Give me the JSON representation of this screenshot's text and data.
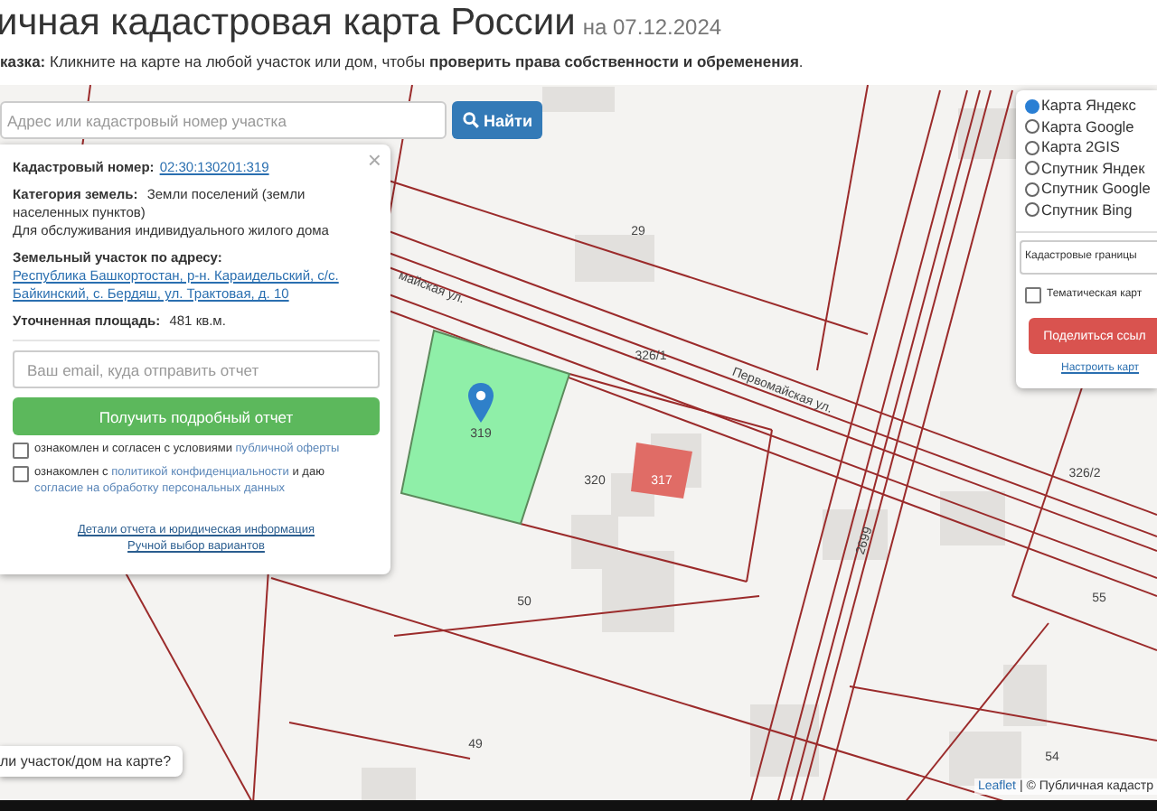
{
  "header": {
    "title": "ичная кадастровая карта России",
    "date": "на 07.12.2024",
    "hint": "**казка:** Кликните на карте на любой участок или дом, чтобы **проверить права собственности и обременения**."
  },
  "search": {
    "placeholder": "Адрес или кадастровый номер участка",
    "button": "Найти"
  },
  "popup": {
    "close": "×",
    "fields": [
      {
        "label": "Кадастровый номер:",
        "value": "02:30:130201:319",
        "kind": "link"
      },
      {
        "label": "Категория земель:",
        "value": "Земли поселений (земли населенных пунктов)",
        "kind": "text"
      },
      {
        "value": "Для обслуживания индивидуального жилого дома",
        "kind": "text"
      },
      {
        "label": "Земельный участок по адресу:",
        "value": "Республика Башкортостан, р-н. Караидельский, с/с. Байкинский, с. Бердяш, ул. Трактовая, д. 10",
        "kind": "link"
      },
      {
        "label": "Уточненная площадь:",
        "value": "481 кв.м.",
        "kind": "text"
      }
    ],
    "email": {
      "placeholder": "Ваш email, куда отправить отчет"
    },
    "report_button": "Получить подробный отчет",
    "agreements": [
      {
        "checked": false,
        "parts": [
          {
            "text": "ознакомлен и согласен с условиями",
            "link": false
          },
          {
            "text": "публичной оферты",
            "link": true
          }
        ]
      },
      {
        "checked": false,
        "parts": [
          {
            "text": "ознакомлен с",
            "link": false
          },
          {
            "text": "политикой конфиденциальности",
            "link": true
          },
          {
            "text": "и даю",
            "link": false
          },
          {
            "text": "согласие на обработку персональных данных",
            "link": true
          }
        ]
      }
    ],
    "links": [
      "Детали отчета и юридическая информация",
      "Ручной выбор вариантов"
    ]
  },
  "layers": {
    "options": [
      {
        "label": "Карта Яндекс",
        "selected": true
      },
      {
        "label": "Карта Google",
        "selected": false
      },
      {
        "label": "Карта 2GIS",
        "selected": false
      },
      {
        "label": "Спутник Яндек",
        "selected": false
      },
      {
        "label": "Спутник Google",
        "selected": false
      },
      {
        "label": "Спутник Bing",
        "selected": false
      }
    ],
    "overlay_select": "Кадастровые границы",
    "thematic": {
      "label": "Тематическая карт",
      "checked": false
    },
    "share_button": "Поделиться ссыл",
    "settings_link": "Настроить карт"
  },
  "map": {
    "labels": [
      "29",
      "326/1",
      "Первомайская ул.",
      "майская ул.",
      "319",
      "320",
      "317",
      "326/2",
      "2699",
      "50",
      "49",
      "55",
      "54"
    ]
  },
  "not_found_button": "ли участок/дом на карте?",
  "attribution": {
    "link": "Leaflet",
    "text": "| © Публичная кадастр"
  }
}
